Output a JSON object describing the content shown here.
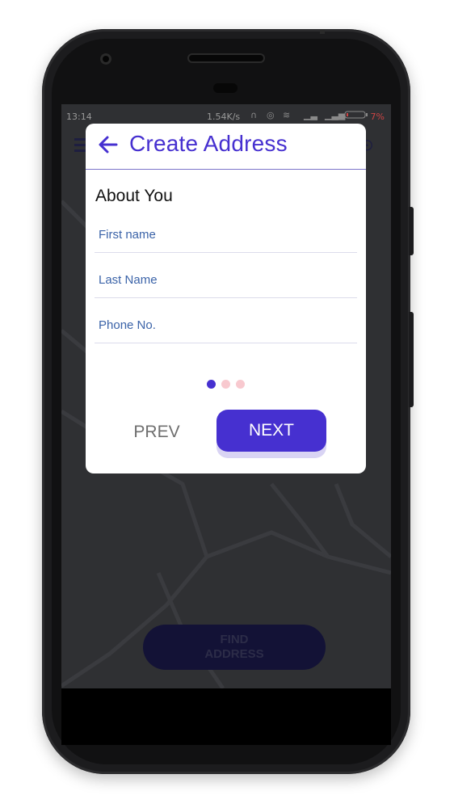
{
  "status_bar": {
    "time": "13:14",
    "speed": "1.54K/s",
    "battery": "7%"
  },
  "modal": {
    "title": "Create Address",
    "section_title": "About You",
    "fields": [
      {
        "placeholder": "First name",
        "value": ""
      },
      {
        "placeholder": "Last Name",
        "value": ""
      },
      {
        "placeholder": "Phone No.",
        "value": ""
      }
    ],
    "pagination": {
      "total": 3,
      "current": 1
    },
    "prev_label": "PREV",
    "next_label": "NEXT"
  },
  "background": {
    "find_line1": "FIND",
    "find_line2": "ADDRESS"
  },
  "colors": {
    "accent": "#4630d0",
    "dot_active": "#4630d0",
    "dot_inactive": "#f8c9cf",
    "map_bg": "#2f3033"
  },
  "icons": {
    "back": "arrow-left-icon",
    "menu": "menu-icon",
    "location": "location-target-icon"
  }
}
